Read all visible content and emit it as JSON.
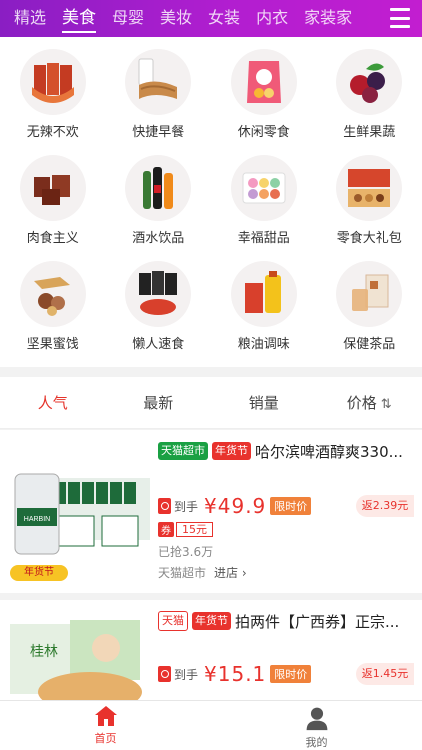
{
  "top_tabs": [
    "精选",
    "美食",
    "母婴",
    "美妆",
    "女装",
    "内衣",
    "家装家"
  ],
  "active_tab": 1,
  "categories": [
    {
      "label": "无辣不欢",
      "icon": "spicy-jerky-icon"
    },
    {
      "label": "快捷早餐",
      "icon": "bread-milk-icon"
    },
    {
      "label": "休闲零食",
      "icon": "snack-bag-icon"
    },
    {
      "label": "生鲜果蔬",
      "icon": "fresh-fruit-icon"
    },
    {
      "label": "肉食主义",
      "icon": "meat-icon"
    },
    {
      "label": "酒水饮品",
      "icon": "drinks-icon"
    },
    {
      "label": "幸福甜品",
      "icon": "macaron-icon"
    },
    {
      "label": "零食大礼包",
      "icon": "gift-box-icon"
    },
    {
      "label": "坚果蜜饯",
      "icon": "nuts-icon"
    },
    {
      "label": "懒人速食",
      "icon": "instant-noodle-icon"
    },
    {
      "label": "粮油调味",
      "icon": "oil-rice-icon"
    },
    {
      "label": "保健茶品",
      "icon": "tea-icon"
    }
  ],
  "sort": {
    "popular": "人气",
    "newest": "最新",
    "sales": "销量",
    "price": "价格",
    "price_arrow": "⇅"
  },
  "products": [
    {
      "badges": [
        "天猫超市",
        "年货节"
      ],
      "title": "哈尔滨啤酒醇爽330...",
      "daoshou": "到手",
      "price": "¥49.9",
      "limit": "限时价",
      "rebate": "返2.39元",
      "coupon_tag": "券",
      "coupon_value": "15元",
      "sold": "已抢3.6万",
      "shop": "天猫超市",
      "enter": "进店 ›",
      "stamp": "年货节"
    },
    {
      "badges": [
        "天猫",
        "年货节"
      ],
      "title": "拍两件【广西券】正宗...",
      "daoshou": "到手",
      "price": "¥15.1",
      "limit": "限时价",
      "rebate": "返1.45元"
    }
  ],
  "bottom_nav": [
    {
      "label": "首页",
      "icon": "home-icon"
    },
    {
      "label": "我的",
      "icon": "user-icon"
    }
  ],
  "colors": {
    "accent": "#e8322d",
    "topbar": "#b21ed0",
    "green": "#1aa043"
  }
}
